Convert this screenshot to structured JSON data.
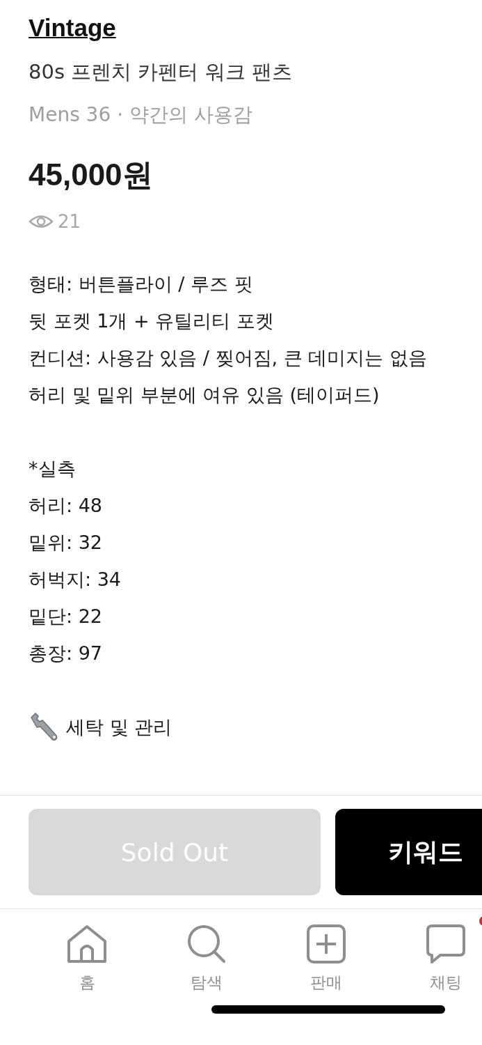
{
  "brand": "Vintage",
  "title": "80s 프렌치 카펜터 워크 팬츠",
  "meta": "Mens 36 · 약간의 사용감",
  "price": "45,000원",
  "views": "21",
  "description": [
    {
      "kind": "text",
      "lines": [
        "형태: 버튼플라이 / 루즈 핏",
        "뒷 포켓 1개 + 유틸리티 포켓",
        "컨디션: 사용감 있음 / 찢어짐, 큰 데미지는 없음",
        "허리 및 밑위 부분에 여유 있음 (테이퍼드)"
      ]
    },
    {
      "kind": "text",
      "lines": [
        "*실측",
        "허리: 48",
        "밑위: 32",
        "허벅지: 34",
        "밑단: 22",
        "총장: 97"
      ]
    },
    {
      "kind": "care",
      "lines": [
        "세탁 및 관리"
      ]
    }
  ],
  "buttons": [
    {
      "label": "Sold Out",
      "disabled": true
    },
    {
      "label": "키워드",
      "disabled": false
    }
  ],
  "nav": [
    {
      "kind": "home",
      "label": "홈",
      "badge": false
    },
    {
      "kind": "search",
      "label": "탐색",
      "badge": false
    },
    {
      "kind": "sell",
      "label": "판매",
      "badge": false
    },
    {
      "kind": "chat",
      "label": "채팅",
      "badge": true
    }
  ]
}
